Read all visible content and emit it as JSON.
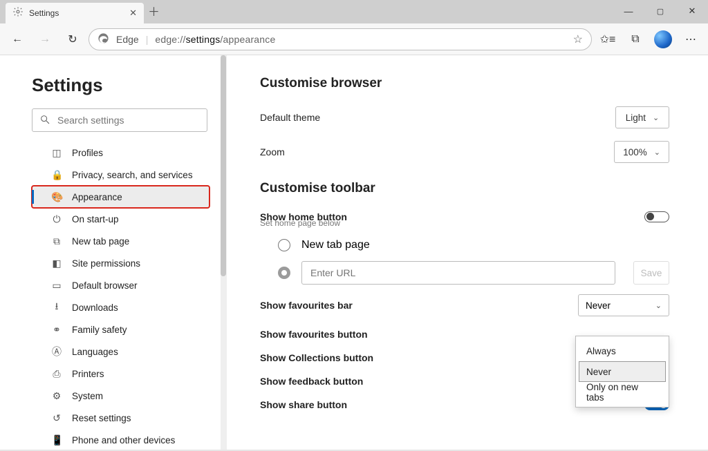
{
  "window": {
    "tab_title": "Settings",
    "url_prefix_label": "Edge",
    "url_plain_before": "edge://",
    "url_bold": "settings",
    "url_plain_after": "/appearance"
  },
  "sidebar": {
    "heading": "Settings",
    "search_placeholder": "Search settings",
    "items": [
      {
        "icon": "profile-card-icon",
        "label": "Profiles"
      },
      {
        "icon": "lock-icon",
        "label": "Privacy, search, and services"
      },
      {
        "icon": "palette-icon",
        "label": "Appearance"
      },
      {
        "icon": "power-icon",
        "label": "On start-up"
      },
      {
        "icon": "new-tab-icon",
        "label": "New tab page"
      },
      {
        "icon": "permissions-icon",
        "label": "Site permissions"
      },
      {
        "icon": "browser-icon",
        "label": "Default browser"
      },
      {
        "icon": "download-icon",
        "label": "Downloads"
      },
      {
        "icon": "family-icon",
        "label": "Family safety"
      },
      {
        "icon": "languages-icon",
        "label": "Languages"
      },
      {
        "icon": "printer-icon",
        "label": "Printers"
      },
      {
        "icon": "system-icon",
        "label": "System"
      },
      {
        "icon": "reset-icon",
        "label": "Reset settings"
      },
      {
        "icon": "phone-icon",
        "label": "Phone and other devices"
      }
    ],
    "selected_index": 2
  },
  "main": {
    "section1_heading": "Customise browser",
    "theme_label": "Default theme",
    "theme_value": "Light",
    "zoom_label": "Zoom",
    "zoom_value": "100%",
    "section2_heading": "Customise toolbar",
    "home_label": "Show home button",
    "home_subtext": "Set home page below",
    "home_toggle": false,
    "radio_new_tab_label": "New tab page",
    "url_placeholder": "Enter URL",
    "save_label": "Save",
    "fav_bar_label": "Show favourites bar",
    "fav_bar_value": "Never",
    "fav_bar_options": [
      "Always",
      "Never",
      "Only on new tabs"
    ],
    "fav_bar_selected_option_index": 1,
    "fav_button_label": "Show favourites button",
    "collections_label": "Show Collections button",
    "feedback_label": "Show feedback button",
    "share_label": "Show share button"
  }
}
